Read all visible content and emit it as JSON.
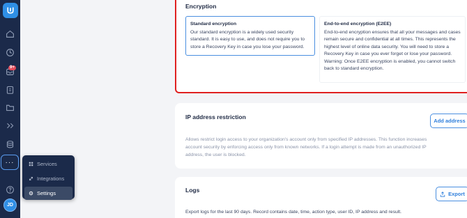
{
  "sidebar": {
    "badge_count": "9+",
    "avatar_initials": "JD",
    "more_label": "···",
    "icons": [
      "home-icon",
      "clock-icon",
      "inbox-icon",
      "clipboard-icon",
      "folder-icon",
      "arrows-icon",
      "database-icon",
      "help-icon"
    ]
  },
  "menu": {
    "items": [
      {
        "label": "Services",
        "icon": "services-icon"
      },
      {
        "label": "Integrations",
        "icon": "integrations-icon"
      },
      {
        "label": "Settings",
        "icon": "gear-icon",
        "active": true
      }
    ]
  },
  "encryption": {
    "title": "Encryption",
    "standard": {
      "title": "Standard encryption",
      "text": "Our standard encryption is a widely used security standard. It is easy to use, and does not require you to store a Recovery Key in case you lose your password."
    },
    "e2ee": {
      "title": "End-to-end encryption (E2EE)",
      "text": "End-to-end encryption ensures that all your messages and cases remain secure and confidential at all times. This represents the highest level of online data security. You will need to store a Recovery Key in case you ever forget or lose your password. Warning: Once E2EE encryption is enabled, you cannot switch back to standard encryption."
    }
  },
  "ip": {
    "title": "IP address restriction",
    "button": "Add address",
    "description": "Allows restrict login access to your organization's account only from specified IP addresses. This function increases account security by enforcing access only from known networks. If a login attempt is made from an unauthorized IP address, the user is blocked."
  },
  "logs": {
    "title": "Logs",
    "button": "Export",
    "description": "Export logs for the last 90 days. Record contains date, time, action type, user ID, IP address and result."
  },
  "colors": {
    "sidebar": "#1b2a4a",
    "accent": "#2f8fe6",
    "highlight_border": "#e02020",
    "badge": "#e14b5a"
  }
}
